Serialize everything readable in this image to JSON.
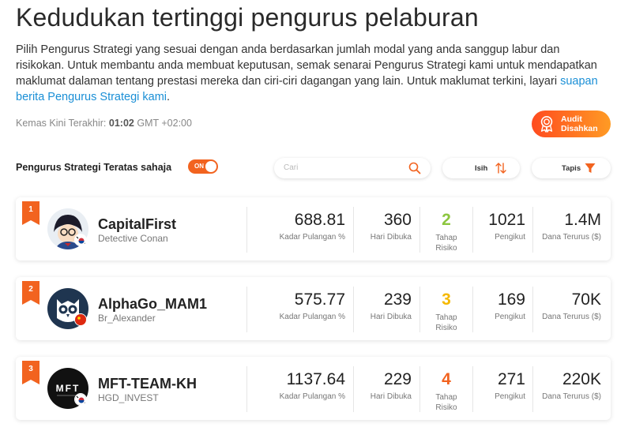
{
  "page": {
    "title": "Kedudukan tertinggi pengurus pelaburan",
    "description": "Pilih Pengurus Strategi yang sesuai dengan anda berdasarkan jumlah modal yang anda sanggup labur dan risikokan. Untuk membantu anda membuat keputusan, semak senarai Pengurus Strategi kami untuk mendapatkan maklumat dalaman tentang prestasi mereka dan ciri-ciri dagangan yang lain. Untuk maklumat terkini, layari",
    "description_link": "suapan berita Pengurus Strategi kami",
    "description_end": ".",
    "updated_label": "Kemas Kini Terakhir:",
    "updated_time": "01:02",
    "updated_tz": "GMT +02:00"
  },
  "audit": {
    "line1": "Audit",
    "line2": "Disahkan",
    "icon": "medal-icon"
  },
  "filters": {
    "toggle_label": "Pengurus Strategi Teratas sahaja",
    "toggle_state": "ON",
    "search_placeholder": "Cari",
    "sort_label": "Isih",
    "filter_label": "Tapis"
  },
  "labels": {
    "return": "Kadar Pulangan %",
    "days": "Hari Dibuka",
    "risk_line1": "Tahap",
    "risk_line2": "Risiko",
    "followers": "Pengikut",
    "funds": "Dana Terurus ($)"
  },
  "colors": {
    "accent": "#f2631f",
    "link": "#1a8fd6",
    "risk_low": "#8cc63f",
    "risk_mid": "#f5b800",
    "risk_high": "#f2631f"
  },
  "managers": [
    {
      "rank": "1",
      "name": "CapitalFirst",
      "handle": "Detective Conan",
      "return": "688.81",
      "days": "360",
      "risk": "2",
      "risk_color": "#8cc63f",
      "followers": "1021",
      "funds": "1.4M",
      "flag": "south-korea-flag-icon"
    },
    {
      "rank": "2",
      "name": "AlphaGo_MAM1",
      "handle": "Br_Alexander",
      "return": "575.77",
      "days": "239",
      "risk": "3",
      "risk_color": "#f5b800",
      "followers": "169",
      "funds": "70K",
      "flag": "china-flag-icon"
    },
    {
      "rank": "3",
      "name": "MFT-TEAM-KH",
      "handle": "HGD_INVEST",
      "return": "1137.64",
      "days": "229",
      "risk": "4",
      "risk_color": "#f2631f",
      "followers": "271",
      "funds": "220K",
      "flag": "south-korea-flag-icon"
    }
  ]
}
